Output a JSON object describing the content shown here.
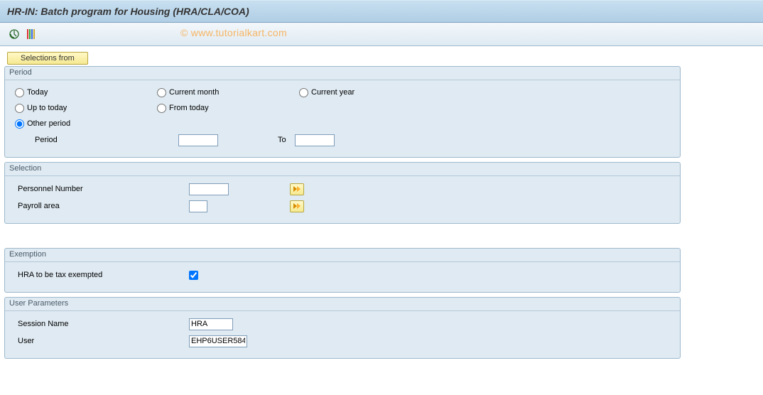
{
  "title": "HR-IN: Batch program for Housing (HRA/CLA/COA)",
  "watermark": "© www.tutorialkart.com",
  "selections_button": "Selections from",
  "period": {
    "title": "Period",
    "today": "Today",
    "current_month": "Current month",
    "current_year": "Current year",
    "up_to_today": "Up to today",
    "from_today": "From today",
    "other_period": "Other period",
    "period_label": "Period",
    "to_label": "To",
    "from_value": "",
    "to_value": ""
  },
  "selection": {
    "title": "Selection",
    "personnel_number": "Personnel Number",
    "personnel_value": "",
    "payroll_area": "Payroll area",
    "payroll_value": ""
  },
  "exemption": {
    "title": "Exemption",
    "hra_label": "HRA to be tax exempted",
    "hra_checked": true
  },
  "user_params": {
    "title": "User Parameters",
    "session_label": "Session Name",
    "session_value": "HRA",
    "user_label": "User",
    "user_value": "EHP6USER584"
  }
}
